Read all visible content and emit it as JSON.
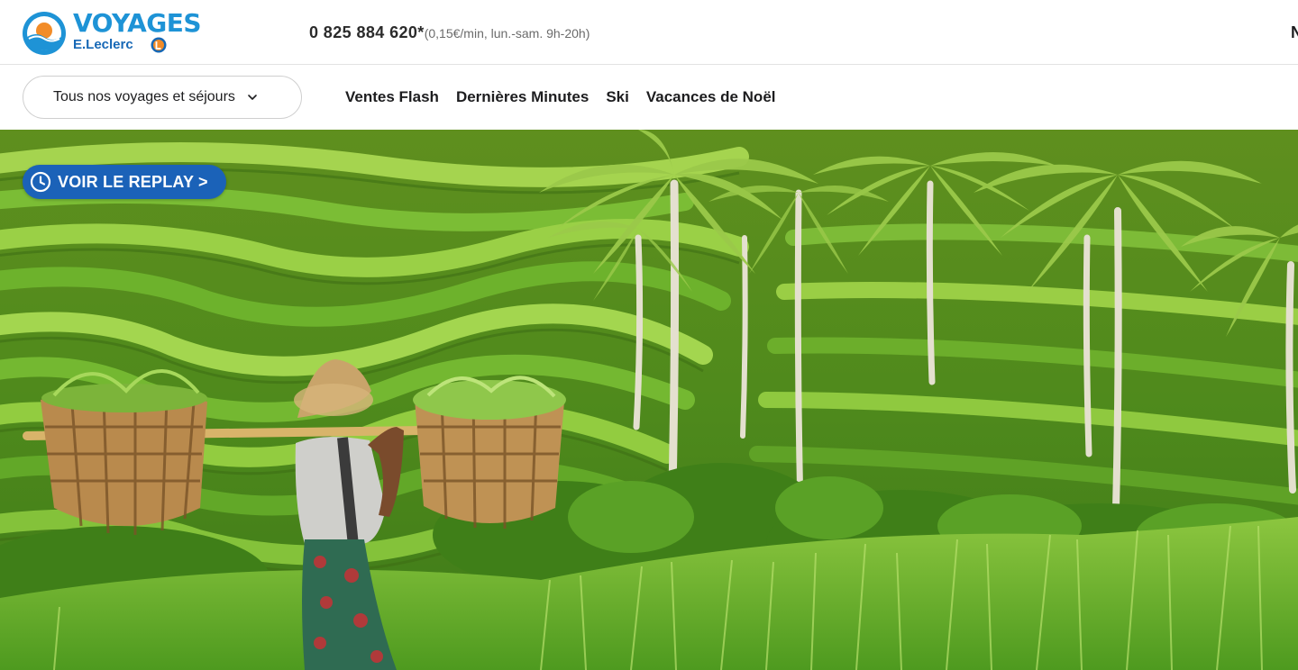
{
  "header": {
    "logo": {
      "wordmark": "VOYAGES",
      "brand": "E.Leclerc"
    },
    "phone": {
      "number": "0 825 884 620*",
      "note": "(0,15€/min, lun.-sam. 9h-20h)"
    },
    "cut_text": "N"
  },
  "nav": {
    "trips_dropdown": {
      "label": "Tous nos voyages et séjours",
      "icon": "chevron-down-icon"
    },
    "links": [
      {
        "label": "Ventes Flash"
      },
      {
        "label": "Dernières Minutes"
      },
      {
        "label": "Ski"
      },
      {
        "label": "Vacances de Noël"
      }
    ]
  },
  "hero": {
    "replay_button": {
      "label": "VOIR LE REPLAY >",
      "icon": "clock-icon"
    },
    "image": "rice-terraces-farmer-palms"
  },
  "colors": {
    "brand_blue": "#1e93d6",
    "brand_dark_blue": "#1768b6",
    "replay_blue": "#1b62b8",
    "badge_orange": "#f28c28"
  }
}
